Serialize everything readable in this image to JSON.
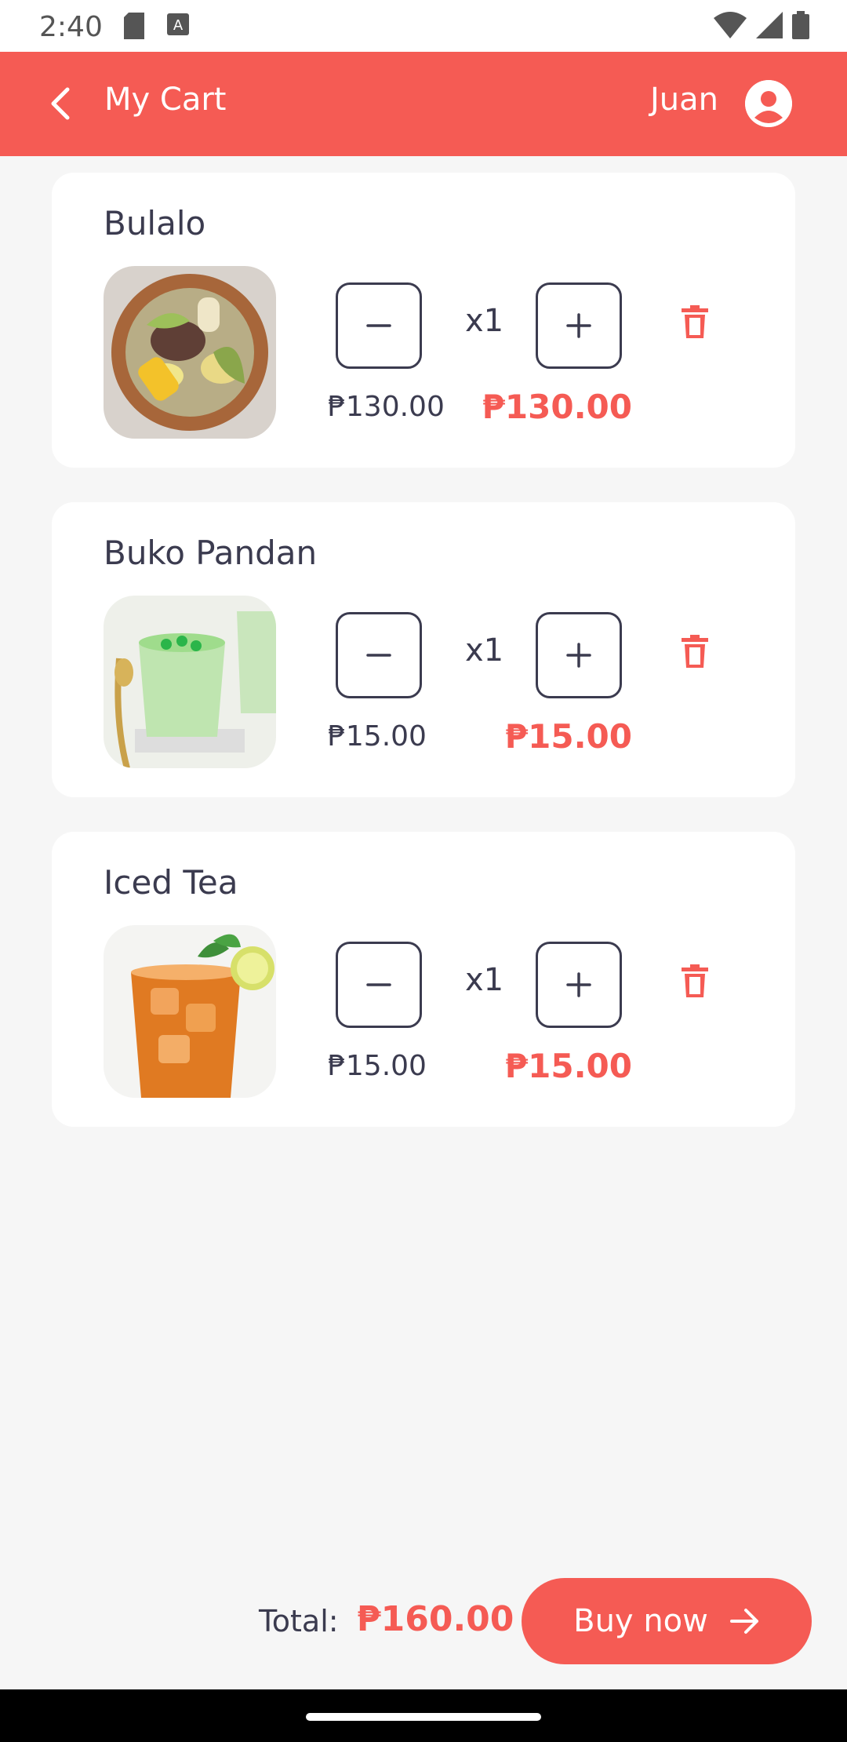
{
  "status": {
    "time": "2:40",
    "icons_left": [
      "sd-card-icon",
      "keyboard-a-icon"
    ],
    "icons_right": [
      "wifi-icon",
      "signal-icon",
      "battery-icon"
    ]
  },
  "header": {
    "title": "My Cart",
    "user_name": "Juan",
    "back_icon": "chevron-left-icon",
    "avatar_icon": "account-circle-icon",
    "color": "#f55b54"
  },
  "cart": {
    "items": [
      {
        "name": "Bulalo",
        "quantity": "x1",
        "unit_price": "₱130.00",
        "line_total": "₱130.00",
        "image": "bulalo-food-image"
      },
      {
        "name": "Buko Pandan",
        "quantity": "x1",
        "unit_price": "₱15.00",
        "line_total": "₱15.00",
        "image": "buko-pandan-food-image"
      },
      {
        "name": "Iced Tea",
        "quantity": "x1",
        "unit_price": "₱15.00",
        "line_total": "₱15.00",
        "image": "iced-tea-drink-image"
      }
    ]
  },
  "footer": {
    "total_label": "Total:",
    "total_value": "₱160.00",
    "buy_label": "Buy now",
    "buy_icon": "arrow-right-icon"
  },
  "colors": {
    "accent": "#f55b54",
    "text": "#3b3b4f",
    "background": "#f6f6f6"
  }
}
